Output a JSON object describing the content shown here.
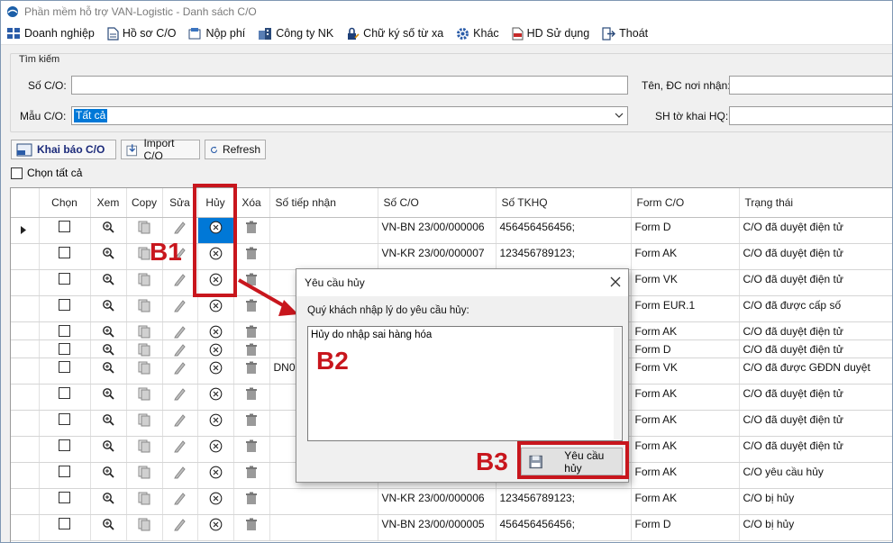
{
  "window": {
    "title": "Phần mềm hỗ trợ VAN-Logistic - Danh sách C/O"
  },
  "menu": [
    {
      "label": "Doanh nghiệp",
      "icon": "building-grid-icon"
    },
    {
      "label": "Hồ sơ C/O",
      "icon": "document-icon"
    },
    {
      "label": "Nộp phí",
      "icon": "fee-icon"
    },
    {
      "label": "Công ty NK",
      "icon": "company-icon"
    },
    {
      "label": "Chữ ký số từ xa",
      "icon": "lock-signature-icon"
    },
    {
      "label": "Khác",
      "icon": "gear-icon"
    },
    {
      "label": "HD Sử dụng",
      "icon": "pdf-icon"
    },
    {
      "label": "Thoát",
      "icon": "exit-icon"
    }
  ],
  "search": {
    "group_label": "Tìm kiếm",
    "co_number_label": "Số C/O:",
    "co_number_value": "",
    "recipient_label": "Tên, ĐC nơi nhận:",
    "recipient_value": "",
    "co_form_label": "Mẫu C/O:",
    "co_form_value": "Tất cả",
    "customs_decl_label": "SH tờ khai HQ:",
    "customs_decl_value": ""
  },
  "toolbar": {
    "declare_label": "Khai báo C/O",
    "import_label": "Import C/O",
    "refresh_label": "Refresh",
    "select_all_label": "Chọn tất cả"
  },
  "grid": {
    "columns": [
      "Chọn",
      "Xem",
      "Copy",
      "Sửa",
      "Hủy",
      "Xóa",
      "Số tiếp nhận",
      "Số C/O",
      "Số TKHQ",
      "Form C/O",
      "Trạng thái"
    ],
    "rows": [
      {
        "so_tiep_nhan": "",
        "so_co": "VN-BN 23/00/000006",
        "so_tkhq": "456456456456;",
        "form": "Form D",
        "status": "C/O đã duyệt điện tử"
      },
      {
        "so_tiep_nhan": "",
        "so_co": "VN-KR 23/00/000007",
        "so_tkhq": "123456789123;",
        "form": "Form AK",
        "status": "C/O đã duyệt điện tử"
      },
      {
        "so_tiep_nhan": "",
        "so_co": "",
        "so_tkhq": "",
        "form": "Form VK",
        "status": "C/O đã duyệt điện tử"
      },
      {
        "so_tiep_nhan": "",
        "so_co": "",
        "so_tkhq": "",
        "form": "Form EUR.1",
        "status": "C/O đã được cấp số"
      },
      {
        "so_tiep_nhan": "",
        "so_co": "",
        "so_tkhq": "",
        "form": "Form AK",
        "status": "C/O đã duyệt điện tử"
      },
      {
        "so_tiep_nhan": "",
        "so_co": "",
        "so_tkhq": "",
        "form": "Form D",
        "status": "C/O đã duyệt điện tử"
      },
      {
        "so_tiep_nhan": "DN00",
        "so_co": "",
        "so_tkhq": "",
        "form": "Form VK",
        "status": "C/O đã được GĐDN duyệt"
      },
      {
        "so_tiep_nhan": "",
        "so_co": "",
        "so_tkhq": "",
        "form": "Form AK",
        "status": "C/O đã duyệt điện tử"
      },
      {
        "so_tiep_nhan": "",
        "so_co": "",
        "so_tkhq": "",
        "form": "Form AK",
        "status": "C/O đã duyệt điện tử"
      },
      {
        "so_tiep_nhan": "",
        "so_co": "",
        "so_tkhq": "",
        "form": "Form AK",
        "status": "C/O đã duyệt điện tử"
      },
      {
        "so_tiep_nhan": "",
        "so_co": "",
        "so_tkhq": "",
        "form": "Form AK",
        "status": "C/O yêu cầu hủy"
      },
      {
        "so_tiep_nhan": "",
        "so_co": "VN-KR 23/00/000006",
        "so_tkhq": "123456789123;",
        "form": "Form AK",
        "status": "C/O bị hủy"
      },
      {
        "so_tiep_nhan": "",
        "so_co": "VN-BN 23/00/000005",
        "so_tkhq": "456456456456;",
        "form": "Form D",
        "status": "C/O bị hủy"
      }
    ]
  },
  "dialog": {
    "title": "Yêu cầu hủy",
    "prompt": "Quý khách nhập lý do yêu cầu hủy:",
    "reason_value": "Hủy do nhập sai hàng hóa",
    "submit_label": "Yêu cầu hủy"
  },
  "annotations": {
    "step1": "B1",
    "step2": "B2",
    "step3": "B3",
    "color": "#c8161d"
  },
  "colors": {
    "selection": "#0078d7",
    "window_bg": "#f0f0f0"
  }
}
